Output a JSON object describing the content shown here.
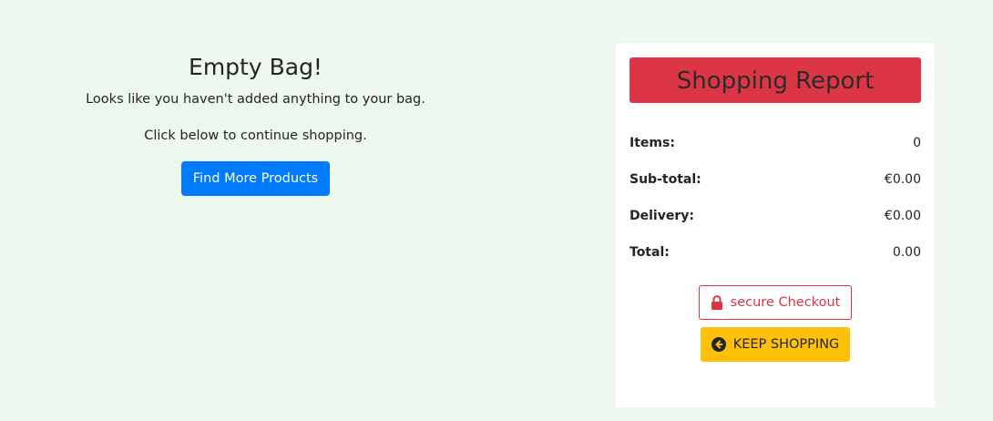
{
  "empty_bag": {
    "title": "Empty Bag!",
    "message": "Looks like you haven't added anything to your bag.",
    "prompt": "Click below to continue shopping.",
    "find_button_label": "Find More Products"
  },
  "report": {
    "title": "Shopping Report",
    "rows": [
      {
        "label": "Items:",
        "value": "0"
      },
      {
        "label": "Sub-total:",
        "value": "€0.00"
      },
      {
        "label": "Delivery:",
        "value": "€0.00"
      },
      {
        "label": "Total:",
        "value": "0.00"
      }
    ],
    "checkout_button_label": "secure Checkout",
    "checkout_icon": "lock-icon",
    "keep_shopping_label": "KEEP SHOPPING",
    "keep_shopping_icon": "arrow-circle-left-icon"
  },
  "colors": {
    "background": "#eff8ee",
    "primary": "#007bff",
    "danger": "#dc3545",
    "warning": "#ffc107"
  }
}
